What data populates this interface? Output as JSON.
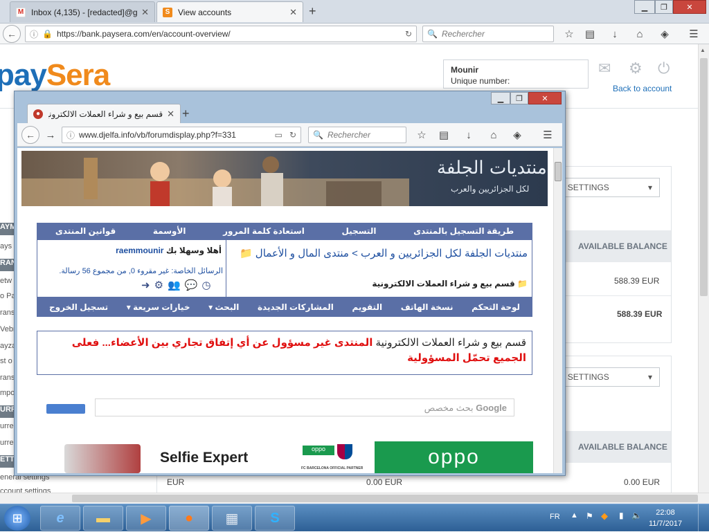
{
  "browser": {
    "tabs": [
      {
        "title": "Inbox (4,135) - [redacted]@gmai",
        "icon": "gmail-icon",
        "active": false
      },
      {
        "title": "View accounts",
        "icon": "paysera-icon",
        "active": true
      }
    ],
    "new_tab": "+",
    "url": "https://bank.paysera.com/en/account-overview/",
    "search_placeholder": "Rechercher"
  },
  "paysera": {
    "logo_main": "pay",
    "logo_accent": "Sera",
    "user_name": "Mounir",
    "unique_number_label": "Unique number:",
    "back_to_account": "Back to account",
    "account_settings_label": "COUNT SETTINGS",
    "available_balance_label": "AVAILABLE BALANCE",
    "balance_1": "588.39 EUR",
    "balance_2": "588.39 EUR",
    "balance_eur_label": "EUR",
    "balance_zero_1": "0.00 EUR",
    "balance_zero_2": "0.00 EUR",
    "sidebar_items": [
      "AYM",
      "ays",
      "RAN",
      "etw",
      "o Pa",
      "rans",
      "Vebr",
      "ayza",
      "st o",
      "rans",
      "mpo",
      "URR",
      "urre",
      "urre",
      "ETT",
      "eneral settings",
      "ccount settings"
    ]
  },
  "inner_browser": {
    "tab_title": "قسم بيع و شراء العملات الالكترونية",
    "new_tab": "+",
    "url": "www.djelfa.info/vb/forumdisplay.php?f=331",
    "search_placeholder": "Rechercher",
    "forum": {
      "banner_title": "منتديات الجلفة",
      "banner_subtitle": "لكل الجزائريين والعرب",
      "top_nav": [
        "طريقة التسجيل بالمنتدى",
        "التسجيل",
        "استعادة كلمة المرور",
        "الأوسمة",
        "قوانين المنتدى"
      ],
      "breadcrumb_site": "منتديات الجلفة لكل الجزائريين و العرب",
      "breadcrumb_sep": ">",
      "breadcrumb_section": "منتدى المال و الأعمال",
      "breadcrumb_current": "قسم بيع و شراء العملات الالكترونية",
      "welcome_prefix": "أهلا وسهلا بك",
      "username": "raemmounir",
      "private_messages": "الرسائل الخاصة: غير مقروء 0, من مجموع 56 رسالة.",
      "bottom_nav": [
        "لوحة التحكم",
        "نسخة الهاتف",
        "التقويم",
        "المشاركات الجديدة",
        "البحث",
        "خيارات سريعة",
        "تسجيل الخروج"
      ],
      "notice_part1": "قسم بيع و شراء العملات الالكترونية",
      "notice_part2": "المنتدى غير مسؤول عن أي إتفاق تجاري بين الأعضاء... فعلى الجميع تحمّل المسؤولية",
      "google_brand": "Google",
      "google_search": "بحث مخصص",
      "ad_text": "Selfie Expert",
      "ad_brand": "oppo",
      "ad_partner": "FC BARCELONA OFFICIAL PARTNER"
    }
  },
  "taskbar": {
    "apps": [
      "start-icon",
      "ie-icon",
      "explorer-icon",
      "media-icon",
      "firefox-icon",
      "calculator-icon",
      "skype-icon"
    ],
    "lang": "FR",
    "time": "22:08",
    "date": "11/7/2017"
  }
}
